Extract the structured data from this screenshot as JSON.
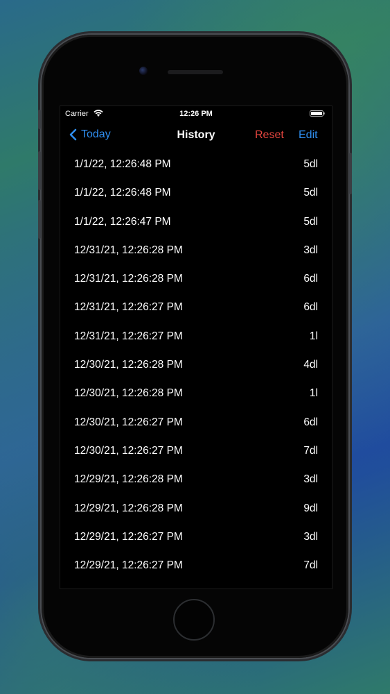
{
  "status_bar": {
    "carrier": "Carrier",
    "time": "12:26 PM"
  },
  "nav": {
    "back_label": "Today",
    "title": "History",
    "reset_label": "Reset",
    "edit_label": "Edit"
  },
  "colors": {
    "accent_blue": "#2f8ef0",
    "destructive_red": "#e5463f",
    "background": "#000000"
  },
  "entries": [
    {
      "date": "1/1/22, 12:26:48 PM",
      "amount": "5dl"
    },
    {
      "date": "1/1/22, 12:26:48 PM",
      "amount": "5dl"
    },
    {
      "date": "1/1/22, 12:26:47 PM",
      "amount": "5dl"
    },
    {
      "date": "12/31/21, 12:26:28 PM",
      "amount": "3dl"
    },
    {
      "date": "12/31/21, 12:26:28 PM",
      "amount": "6dl"
    },
    {
      "date": "12/31/21, 12:26:27 PM",
      "amount": "6dl"
    },
    {
      "date": "12/31/21, 12:26:27 PM",
      "amount": "1l"
    },
    {
      "date": "12/30/21, 12:26:28 PM",
      "amount": "4dl"
    },
    {
      "date": "12/30/21, 12:26:28 PM",
      "amount": "1l"
    },
    {
      "date": "12/30/21, 12:26:27 PM",
      "amount": "6dl"
    },
    {
      "date": "12/30/21, 12:26:27 PM",
      "amount": "7dl"
    },
    {
      "date": "12/29/21, 12:26:28 PM",
      "amount": "3dl"
    },
    {
      "date": "12/29/21, 12:26:28 PM",
      "amount": "9dl"
    },
    {
      "date": "12/29/21, 12:26:27 PM",
      "amount": "3dl"
    },
    {
      "date": "12/29/21, 12:26:27 PM",
      "amount": "7dl"
    }
  ]
}
